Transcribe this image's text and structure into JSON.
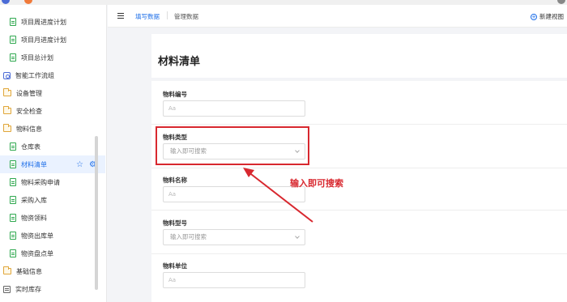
{
  "sidebar": {
    "items": [
      {
        "label": "项目周进度计划",
        "icon": "doc-icon"
      },
      {
        "label": "项目月进度计划",
        "icon": "doc-icon"
      },
      {
        "label": "项目总计划",
        "icon": "doc-icon"
      },
      {
        "label": "智能工作流组",
        "icon": "flow-icon"
      },
      {
        "label": "设备管理",
        "icon": "folder-icon"
      },
      {
        "label": "安全检查",
        "icon": "folder-icon"
      },
      {
        "label": "物料信息",
        "icon": "folder-icon"
      },
      {
        "label": "仓库表",
        "icon": "doc-icon"
      },
      {
        "label": "材料清单",
        "icon": "doc-icon",
        "active": true
      },
      {
        "label": "物料采购申请",
        "icon": "doc-icon"
      },
      {
        "label": "采购入库",
        "icon": "doc-icon"
      },
      {
        "label": "物资领料",
        "icon": "doc-icon"
      },
      {
        "label": "物资出库单",
        "icon": "doc-icon"
      },
      {
        "label": "物资盘点单",
        "icon": "doc-icon"
      },
      {
        "label": "基础信息",
        "icon": "folder-icon"
      },
      {
        "label": "实时库存",
        "icon": "list-icon"
      }
    ]
  },
  "topnav": {
    "tab_fill": "填写数据",
    "tab_manage": "管理数据",
    "new_view": "新建视图"
  },
  "form": {
    "title": "材料清单",
    "fields": [
      {
        "label": "物料编号",
        "type": "input",
        "placeholder": "Aa"
      },
      {
        "label": "物料类型",
        "type": "select",
        "placeholder": "输入即可搜索"
      },
      {
        "label": "物料名称",
        "type": "input",
        "placeholder": "Aa"
      },
      {
        "label": "物料型号",
        "type": "select",
        "placeholder": "输入即可搜索"
      },
      {
        "label": "物料单位",
        "type": "input",
        "placeholder": "Aa"
      }
    ]
  },
  "annotation": {
    "text": "输入即可搜索"
  },
  "colors": {
    "accent": "#1e6fe8",
    "annotation": "#d8282f",
    "active_bg": "#eaf2ff"
  }
}
